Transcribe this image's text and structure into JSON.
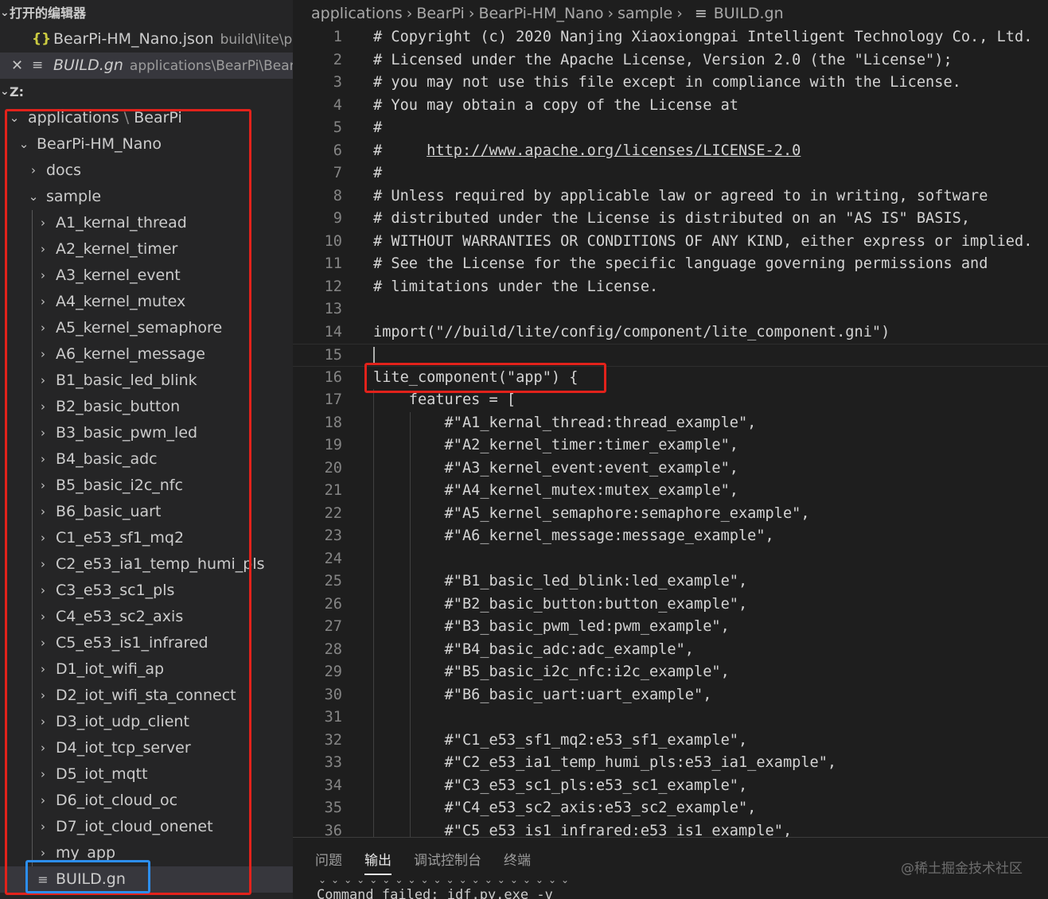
{
  "sidebar": {
    "open_editors_title": "打开的编辑器",
    "open_editors": [
      {
        "icon": "{}",
        "name": "BearPi-HM_Nano.json",
        "path": "build\\lite\\p..."
      },
      {
        "icon": "≡",
        "name": "BUILD.gn",
        "path": "applications\\BearPi\\Bear..."
      }
    ],
    "workspace_title": "Z:",
    "tree": {
      "root_part1": "applications",
      "root_sep": "\\",
      "root_part2": "BearPi",
      "project": "BearPi-HM_Nano",
      "docs": "docs",
      "sample": "sample",
      "folders": [
        "A1_kernal_thread",
        "A2_kernel_timer",
        "A3_kernel_event",
        "A4_kernel_mutex",
        "A5_kernel_semaphore",
        "A6_kernel_message",
        "B1_basic_led_blink",
        "B2_basic_button",
        "B3_basic_pwm_led",
        "B4_basic_adc",
        "B5_basic_i2c_nfc",
        "B6_basic_uart",
        "C1_e53_sf1_mq2",
        "C2_e53_ia1_temp_humi_pls",
        "C3_e53_sc1_pls",
        "C4_e53_sc2_axis",
        "C5_e53_is1_infrared",
        "D1_iot_wifi_ap",
        "D2_iot_wifi_sta_connect",
        "D3_iot_udp_client",
        "D4_iot_tcp_server",
        "D5_iot_mqtt",
        "D6_iot_cloud_oc",
        "D7_iot_cloud_onenet",
        "my_app"
      ],
      "build_file": "BUILD.gn"
    }
  },
  "breadcrumb": [
    "applications",
    "BearPi",
    "BearPi-HM_Nano",
    "sample",
    "BUILD.gn"
  ],
  "editor": {
    "lines": [
      {
        "n": "1",
        "text": "# Copyright (c) 2020 Nanjing Xiaoxiongpai Intelligent Technology Co., Ltd."
      },
      {
        "n": "2",
        "text": "# Licensed under the Apache License, Version 2.0 (the \"License\");"
      },
      {
        "n": "3",
        "text": "# you may not use this file except in compliance with the License."
      },
      {
        "n": "4",
        "text": "# You may obtain a copy of the License at"
      },
      {
        "n": "5",
        "text": "#"
      },
      {
        "n": "6",
        "text": "#     ",
        "url": "http://www.apache.org/licenses/LICENSE-2.0"
      },
      {
        "n": "7",
        "text": "#"
      },
      {
        "n": "8",
        "text": "# Unless required by applicable law or agreed to in writing, software"
      },
      {
        "n": "9",
        "text": "# distributed under the License is distributed on an \"AS IS\" BASIS,"
      },
      {
        "n": "10",
        "text": "# WITHOUT WARRANTIES OR CONDITIONS OF ANY KIND, either express or implied."
      },
      {
        "n": "11",
        "text": "# See the License for the specific language governing permissions and"
      },
      {
        "n": "12",
        "text": "# limitations under the License."
      },
      {
        "n": "13",
        "text": ""
      },
      {
        "n": "14",
        "text": "import(\"//build/lite/config/component/lite_component.gni\")"
      },
      {
        "n": "15",
        "text": ""
      },
      {
        "n": "16",
        "text": "lite_component(\"app\") {"
      },
      {
        "n": "17",
        "text": "    features = ["
      },
      {
        "n": "18",
        "text": "        #\"A1_kernal_thread:thread_example\","
      },
      {
        "n": "19",
        "text": "        #\"A2_kernel_timer:timer_example\","
      },
      {
        "n": "20",
        "text": "        #\"A3_kernel_event:event_example\","
      },
      {
        "n": "21",
        "text": "        #\"A4_kernel_mutex:mutex_example\","
      },
      {
        "n": "22",
        "text": "        #\"A5_kernel_semaphore:semaphore_example\","
      },
      {
        "n": "23",
        "text": "        #\"A6_kernel_message:message_example\","
      },
      {
        "n": "24",
        "text": ""
      },
      {
        "n": "25",
        "text": "        #\"B1_basic_led_blink:led_example\","
      },
      {
        "n": "26",
        "text": "        #\"B2_basic_button:button_example\","
      },
      {
        "n": "27",
        "text": "        #\"B3_basic_pwm_led:pwm_example\","
      },
      {
        "n": "28",
        "text": "        #\"B4_basic_adc:adc_example\","
      },
      {
        "n": "29",
        "text": "        #\"B5_basic_i2c_nfc:i2c_example\","
      },
      {
        "n": "30",
        "text": "        #\"B6_basic_uart:uart_example\","
      },
      {
        "n": "31",
        "text": ""
      },
      {
        "n": "32",
        "text": "        #\"C1_e53_sf1_mq2:e53_sf1_example\","
      },
      {
        "n": "33",
        "text": "        #\"C2_e53_ia1_temp_humi_pls:e53_ia1_example\","
      },
      {
        "n": "34",
        "text": "        #\"C3_e53_sc1_pls:e53_sc1_example\","
      },
      {
        "n": "35",
        "text": "        #\"C4_e53_sc2_axis:e53_sc2_example\","
      },
      {
        "n": "36",
        "text": "        #\"C5_e53_is1_infrared:e53_is1_example\","
      }
    ]
  },
  "panel": {
    "tabs": [
      "问题",
      "输出",
      "调试控制台",
      "终端"
    ],
    "active_tab": "输出",
    "output_line": "Command failed: idf.py.exe -v",
    "watermark": "@稀土掘金技术社区"
  },
  "colors": {
    "highlight_red": "#e2221b",
    "highlight_blue": "#2c8ef0",
    "selected_row": "#37373d"
  }
}
